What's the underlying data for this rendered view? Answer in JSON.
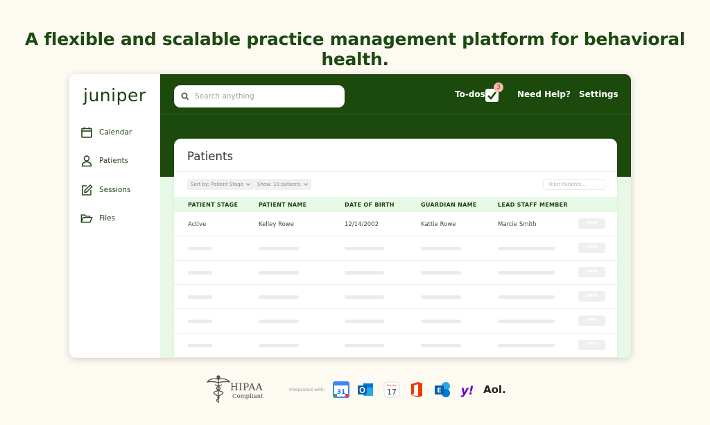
{
  "headline": "A flexible and scalable practice management platform for behavioral health.",
  "app": {
    "logo": "juniper",
    "sidebar": {
      "items": [
        {
          "label": "Calendar",
          "icon": "calendar-icon"
        },
        {
          "label": "Patients",
          "icon": "person-icon"
        },
        {
          "label": "Sessions",
          "icon": "edit-icon"
        },
        {
          "label": "Files",
          "icon": "folder-icon"
        }
      ]
    },
    "topbar": {
      "search_placeholder": "Search anything",
      "todos_label": "To-dos",
      "todos_count": "3",
      "help_label": "Need Help?",
      "settings_label": "Settings"
    },
    "patients": {
      "title": "Patients",
      "sort_label": "Sort by: Patient Stage",
      "show_label": "Show: 10 patients",
      "filter_placeholder": "Filter Patients...",
      "columns": [
        "PATIENT STAGE",
        "PATIENT NAME",
        "DATE OF BIRTH",
        "GUARDIAN NAME",
        "LEAD STAFF MEMBER"
      ],
      "rows": [
        {
          "stage": "Active",
          "name": "Kelley Rowe",
          "dob": "12/14/2002",
          "guardian": "Kattie Rowe",
          "staff": "Marcie Smith",
          "action": "VIEW"
        }
      ],
      "placeholder_row_action": "VIEW"
    }
  },
  "footer": {
    "hipaa_title": "HIPAA",
    "hipaa_subtitle": "Compliant",
    "integrated_label": "Integrated with:",
    "integrations": [
      "google-calendar-icon",
      "outlook-icon",
      "apple-calendar-icon",
      "office-icon",
      "exchange-icon",
      "yahoo-icon",
      "aol-logo"
    ],
    "apple_calendar_day": "17",
    "apple_calendar_month": "Monday",
    "google_calendar_day": "31",
    "aol_text": "Aol.",
    "yahoo_text": "y!"
  },
  "colors": {
    "brand_green": "#1b4a0c",
    "headline_green": "#1d4a10",
    "mint": "#e8f8e6",
    "background": "#fdfaf2"
  }
}
